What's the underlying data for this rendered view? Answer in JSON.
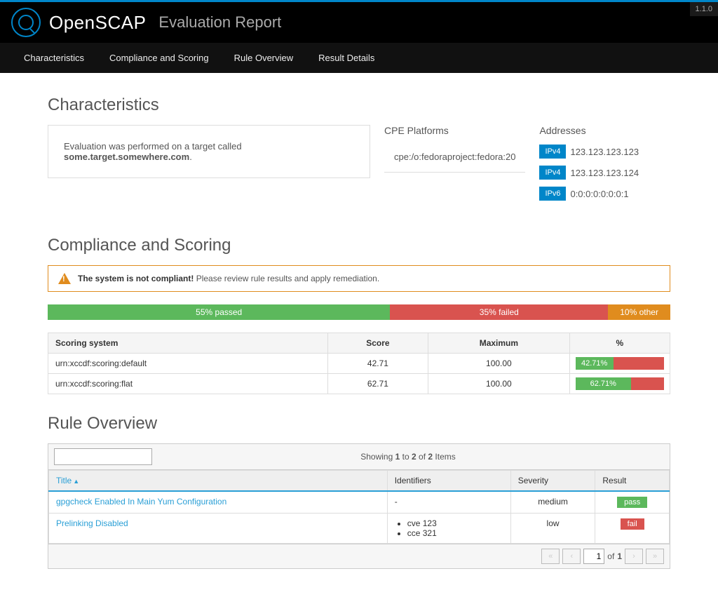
{
  "version": "1.1.0",
  "brand": "OpenSCAP",
  "subtitle": "Evaluation Report",
  "nav": [
    "Characteristics",
    "Compliance and Scoring",
    "Rule Overview",
    "Result Details"
  ],
  "sections": {
    "characteristics": "Characteristics",
    "compliance": "Compliance and Scoring",
    "rules": "Rule Overview"
  },
  "char": {
    "text_prefix": "Evaluation was performed on a target called ",
    "target": "some.target.somewhere.com",
    "cpe_heading": "CPE Platforms",
    "cpe_value": "cpe:/o:fedoraproject:fedora:20",
    "addr_heading": "Addresses",
    "addresses": [
      {
        "type": "IPv4",
        "value": "123.123.123.123",
        "badge_bg": "#0086c9"
      },
      {
        "type": "IPv4",
        "value": "123.123.123.124",
        "badge_bg": "#0086c9"
      },
      {
        "type": "IPv6",
        "value": "0:0:0:0:0:0:0:1",
        "badge_bg": "#0086c9"
      }
    ]
  },
  "alert": {
    "strong": "The system is not compliant!",
    "rest": " Please review rule results and apply remediation."
  },
  "bar": {
    "pass": {
      "label": "55% passed",
      "width": 55
    },
    "fail": {
      "label": "35% failed",
      "width": 35
    },
    "other": {
      "label": "10% other",
      "width": 10
    }
  },
  "score_headers": [
    "Scoring system",
    "Score",
    "Maximum",
    "%"
  ],
  "scores": [
    {
      "system": "urn:xccdf:scoring:default",
      "score": "42.71",
      "max": "100.00",
      "pct": 42.71,
      "pct_label": "42.71%"
    },
    {
      "system": "urn:xccdf:scoring:flat",
      "score": "62.71",
      "max": "100.00",
      "pct": 62.71,
      "pct_label": "62.71%"
    }
  ],
  "rules": {
    "showing": {
      "prefix": "Showing ",
      "from": "1",
      "to_word": " to ",
      "to": "2",
      "of_word": " of ",
      "total": "2",
      "suffix": " Items"
    },
    "headers": {
      "title": "Title",
      "id": "Identifiers",
      "sev": "Severity",
      "res": "Result"
    },
    "rows": [
      {
        "title": "gpgcheck Enabled In Main Yum Configuration",
        "ids": [
          "-"
        ],
        "id_plain": true,
        "severity": "medium",
        "result": "pass"
      },
      {
        "title": "Prelinking Disabled",
        "ids": [
          "cve 123",
          "cce 321"
        ],
        "id_plain": false,
        "severity": "low",
        "result": "fail"
      }
    ],
    "pager": {
      "page": "1",
      "of": "of",
      "total": "1"
    }
  }
}
